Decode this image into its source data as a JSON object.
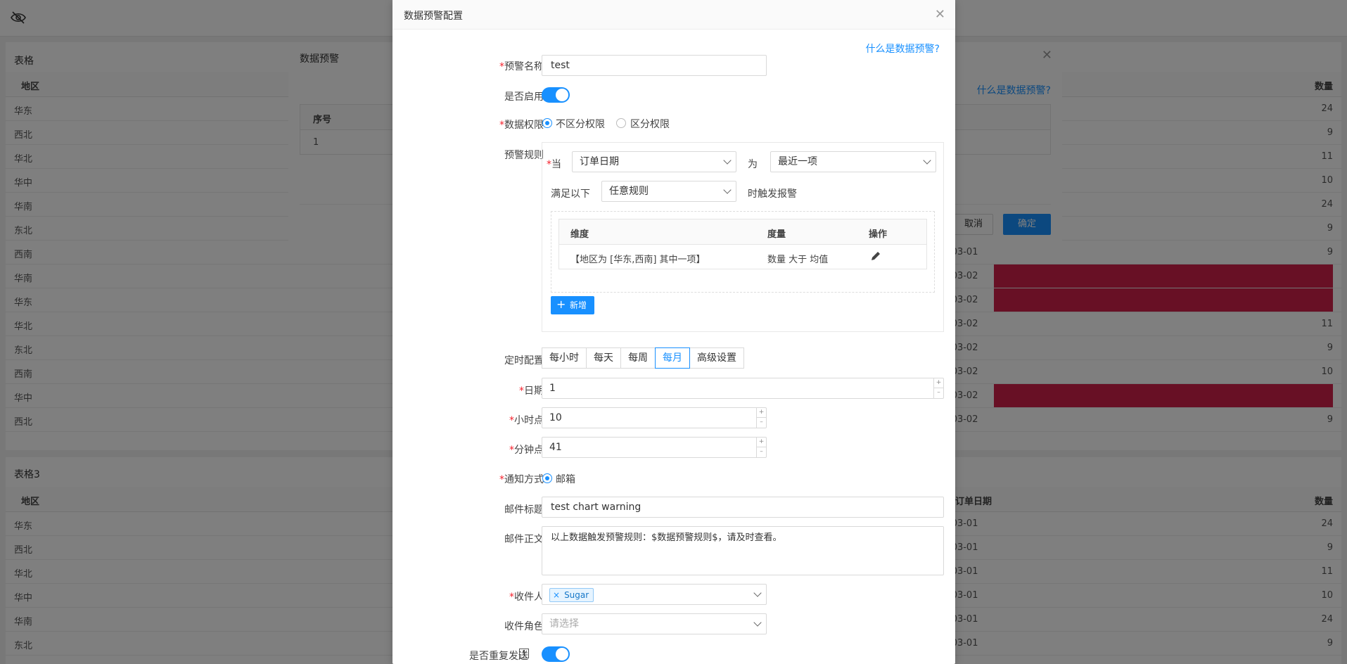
{
  "background": {
    "table1_title": "表格",
    "table3_title": "表格3",
    "col_region": "地区",
    "col_order_date": "订单日期",
    "col_quantity": "数量",
    "table1_rows": [
      {
        "region": "华东",
        "date": "",
        "qty": "24",
        "red": false
      },
      {
        "region": "西北",
        "date": "",
        "qty": "9",
        "red": false
      },
      {
        "region": "华北",
        "date": "",
        "qty": "11",
        "red": false
      },
      {
        "region": "华中",
        "date": "",
        "qty": "10",
        "red": false
      },
      {
        "region": "华南",
        "date": "",
        "qty": "24",
        "red": false
      },
      {
        "region": "东北",
        "date": "",
        "qty": "9",
        "red": false
      },
      {
        "region": "西南",
        "date": "-03-01",
        "qty": "9",
        "red": false
      },
      {
        "region": "华南",
        "date": "-03-02",
        "qty": "",
        "red": true
      },
      {
        "region": "华东",
        "date": "-03-02",
        "qty": "",
        "red": true
      },
      {
        "region": "华北",
        "date": "-03-02",
        "qty": "11",
        "red": false
      },
      {
        "region": "东北",
        "date": "-03-02",
        "qty": "9",
        "red": false
      },
      {
        "region": "西南",
        "date": "-03-02",
        "qty": "10",
        "red": false
      },
      {
        "region": "华中",
        "date": "-03-02",
        "qty": "",
        "red": true
      },
      {
        "region": "西北",
        "date": "-03-02",
        "qty": "9",
        "red": false
      }
    ],
    "table3_rows": [
      {
        "region": "华东",
        "date": "-03-01",
        "qty": "24"
      },
      {
        "region": "西北",
        "date": "-03-01",
        "qty": "9"
      },
      {
        "region": "华北",
        "date": "-03-01",
        "qty": "11"
      },
      {
        "region": "华中",
        "date": "-03-01",
        "qty": "10"
      },
      {
        "region": "华南",
        "date": "-03-01",
        "qty": "24"
      },
      {
        "region": "东北",
        "date": "-03-01",
        "qty": "9"
      }
    ],
    "table3_date_header": "订单日期"
  },
  "modal1": {
    "title": "数据预警",
    "help_link": "什么是数据预警?",
    "col_index": "序号",
    "row_index": "1",
    "cancel": "取消",
    "confirm": "确定"
  },
  "modal2": {
    "title": "数据预警配置",
    "help_link": "什么是数据预警?",
    "name_label": "预警名称",
    "name_value": "test",
    "enable_label": "是否启用",
    "enabled": true,
    "permission_label": "数据权限",
    "permission_options": [
      "不区分权限",
      "区分权限"
    ],
    "permission_selected": 0,
    "rule_label": "预警规则",
    "when_label": "当",
    "when_field": "订单日期",
    "is_label": "为",
    "is_value": "最近一项",
    "satisfy_label": "满足以下",
    "satisfy_value": "任意规则",
    "trigger_label": "时触发报警",
    "rule_table": {
      "headers": [
        "维度",
        "度量",
        "操作"
      ],
      "rows": [
        {
          "dimension": "【地区为 [华东,西南] 其中一项】",
          "measure": "数量 大于 均值"
        }
      ]
    },
    "add_button": "新增",
    "schedule_label": "定时配置",
    "schedule_options": [
      "每小时",
      "每天",
      "每周",
      "每月",
      "高级设置"
    ],
    "schedule_selected": 3,
    "date_label": "日期",
    "date_value": "1",
    "hour_label": "小时点",
    "hour_value": "10",
    "minute_label": "分钟点",
    "minute_value": "41",
    "notify_label": "通知方式",
    "notify_option": "邮箱",
    "mail_subject_label": "邮件标题",
    "mail_subject_value": "test chart warning",
    "mail_body_label": "邮件正文",
    "mail_body_value": "以上数据触发预警规则：$数据预警规则$，请及时查看。",
    "recipient_label": "收件人",
    "recipient_tag": "Sugar",
    "role_label": "收件角色",
    "role_placeholder": "请选择",
    "repeat_label": "是否重复发送",
    "repeat_enabled": true
  },
  "colors": {
    "primary": "#1890ff",
    "alert_red": "#d0204a"
  }
}
